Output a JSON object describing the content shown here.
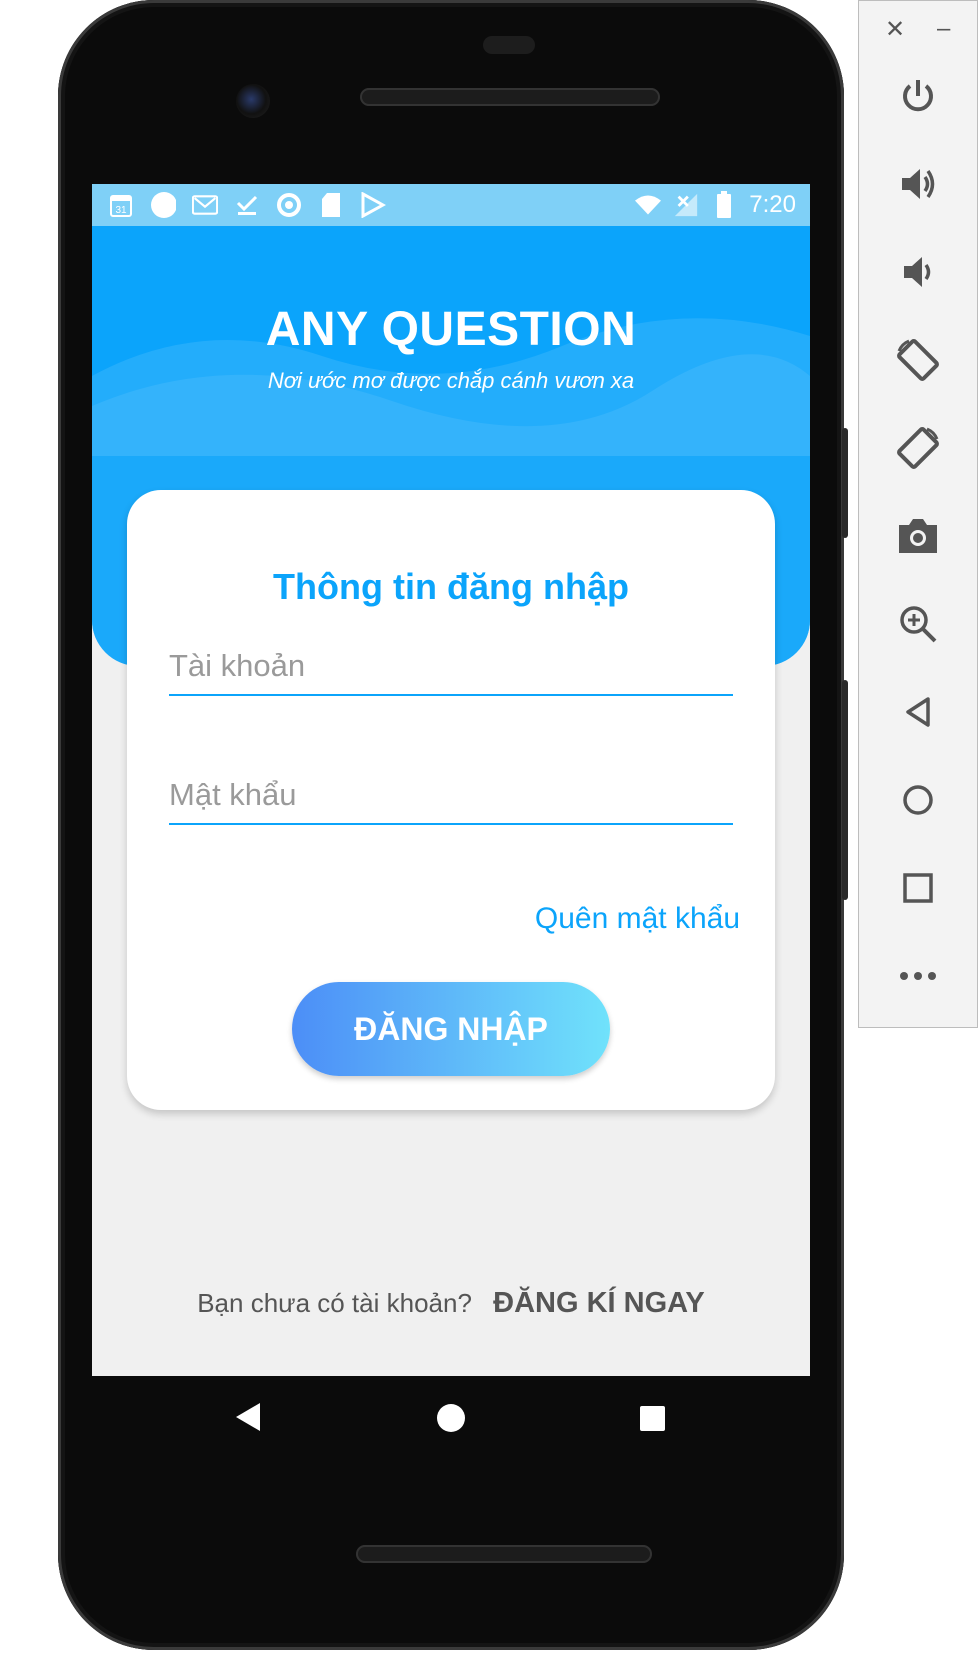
{
  "status_bar": {
    "time": "7:20",
    "calendar_day": "31",
    "left_icons": [
      "calendar-icon",
      "circle-icon",
      "gmail-icon",
      "download-done-icon",
      "sync-icon",
      "sd-card-icon",
      "play-store-icon"
    ],
    "right_icons": [
      "wifi-icon",
      "signal-icon",
      "battery-icon"
    ]
  },
  "header": {
    "title": "ANY QUESTION",
    "subtitle": "Nơi ước mơ được chắp cánh vươn xa"
  },
  "login_card": {
    "title": "Thông tin đăng nhập",
    "username_placeholder": "Tài khoản",
    "password_placeholder": "Mật khẩu",
    "forgot_password": "Quên mật khẩu",
    "login_button": "ĐĂNG NHẬP"
  },
  "register": {
    "prompt": "Bạn chưa có tài khoản?",
    "link": "ĐĂNG KÍ NGAY"
  },
  "nav_bar": [
    "back-icon",
    "home-icon",
    "recents-icon"
  ],
  "emulator_toolbar": {
    "window_controls": [
      "close-icon",
      "minimize-icon"
    ],
    "buttons": [
      "power-icon",
      "volume-up-icon",
      "volume-down-icon",
      "rotate-left-icon",
      "rotate-right-icon",
      "camera-icon",
      "zoom-icon",
      "back-icon",
      "home-icon",
      "overview-icon",
      "more-icon"
    ]
  },
  "colors": {
    "primary": "#0ba4fb",
    "status_bar": "#7fd0f7",
    "button_gradient_start": "#4c8ef7",
    "button_gradient_end": "#70e2fb",
    "screen_background": "#f0f0f0"
  }
}
